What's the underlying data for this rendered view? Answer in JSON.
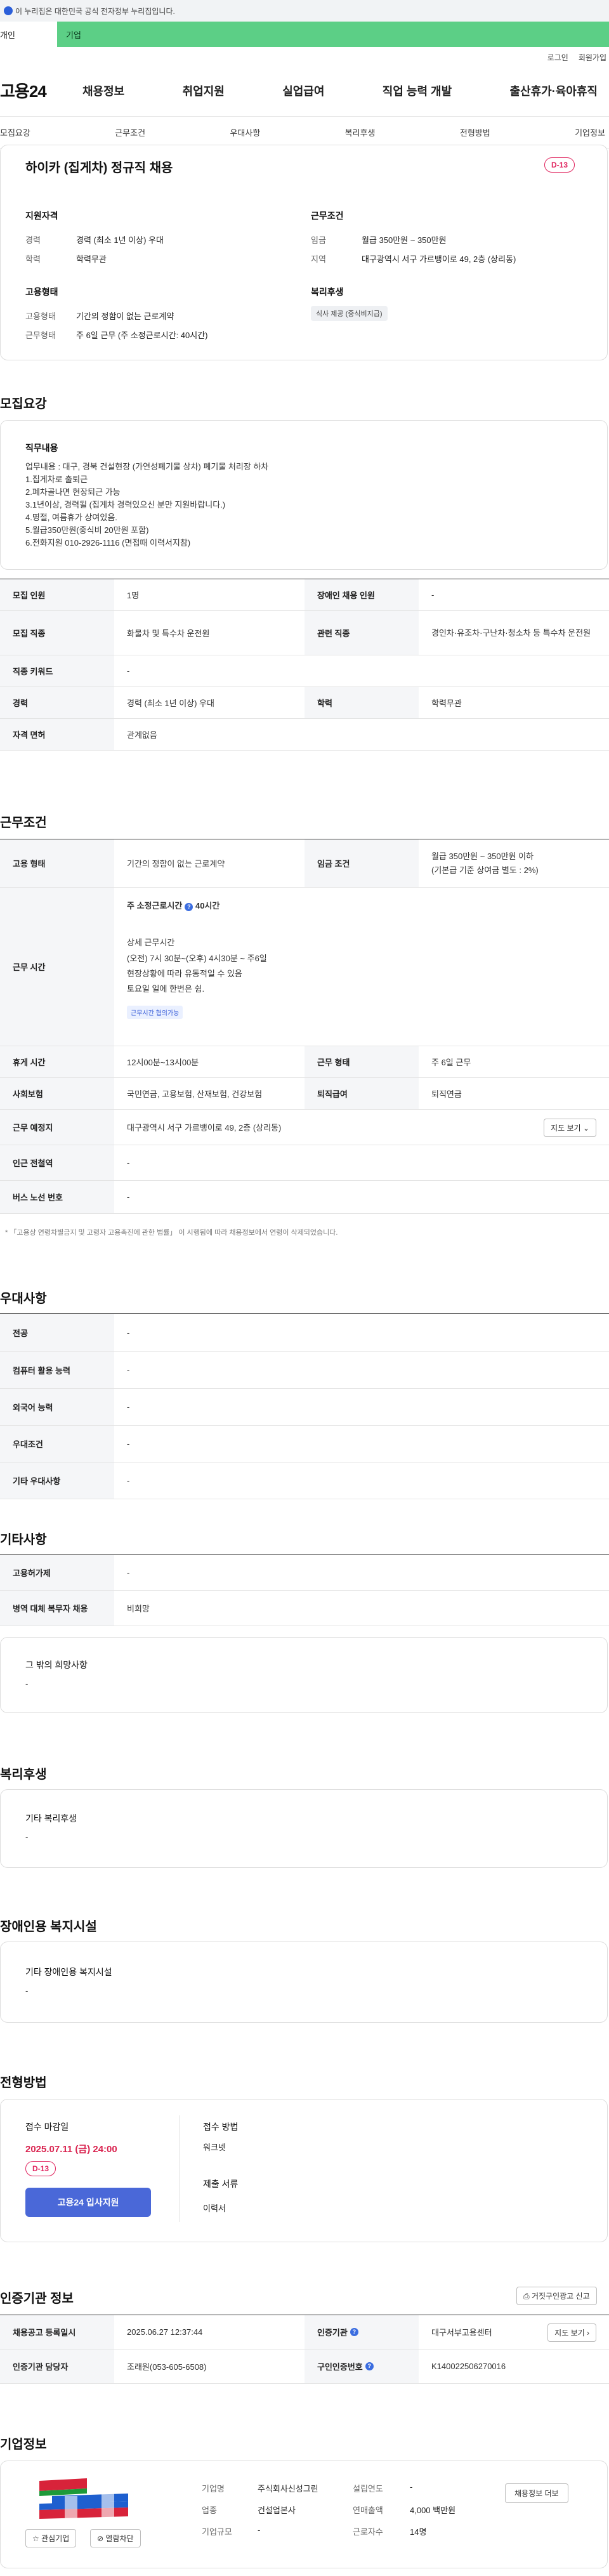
{
  "gov_banner": "이 누리집은 대한민국 공식 전자정부 누리집입니다.",
  "tabs": [
    "개인",
    "기업"
  ],
  "util": [
    "로그인",
    "회원가입"
  ],
  "logo": "고용24",
  "gnb": [
    "채용정보",
    "취업지원",
    "실업급여",
    "직업 능력 개발",
    "출산휴가·육아휴직"
  ],
  "anchors": [
    "모집요강",
    "근무조건",
    "우대사항",
    "복리후생",
    "전형방법",
    "기업정보"
  ],
  "summary": {
    "title": "하이카 (집게차) 정규직 채용",
    "dday": "D-13",
    "qual_title": "지원자격",
    "qual": [
      {
        "l": "경력",
        "v": "경력 (최소 1년 이상) 우대"
      },
      {
        "l": "학력",
        "v": "학력무관"
      }
    ],
    "cond_title": "근무조건",
    "cond": [
      {
        "l": "임금",
        "v": "월급 350만원 ~ 350만원"
      },
      {
        "l": "지역",
        "v": "대구광역시 서구 가르뱅이로 49, 2층 (상리동)"
      }
    ],
    "emp_title": "고용형태",
    "emp": [
      {
        "l": "고용형태",
        "v": "기간의 정함이 없는 근로계약"
      },
      {
        "l": "근무형태",
        "v": "주 6일 근무 (주 소정근로시간: 40시간)"
      }
    ],
    "welfare_title": "복리후생",
    "welfare_chip": "식사 제공 (중식비지급)"
  },
  "recruit": {
    "section": "모집요강",
    "job_title": "직무내용",
    "job_text": "업무내용 : 대구, 경북 건설현장 (가연성폐기물 상차) 폐기물 처리장 하차\n1.집게차로 출퇴근\n2.폐차골나면 현장퇴근 가능\n3.1년이상, 경력될 (집게차 경력있으신 분만 지원바랍니다.)\n4.명절, 여름휴가 상여있음.\n5.월급350만원(중식비 20만원 포함)\n6.전화지원 010-2926-1116 (면접때 이력서지참)",
    "rows": [
      {
        "h1": "모집 인원",
        "v1": "1명",
        "h2": "장애인 채용 인원",
        "v2": "-"
      },
      {
        "h1": "모집 직종",
        "v1": "화물차 및 특수차 운전원",
        "h2": "관련 직종",
        "v2": "경인차·유조차·구난차·청소차 등 특수차 운전원"
      },
      {
        "h1": "직종 키워드",
        "v1": "-"
      },
      {
        "h1": "경력",
        "v1": "경력 (최소 1년 이상) 우대",
        "h2": "학력",
        "v2": "학력무관"
      },
      {
        "h1": "자격 면허",
        "v1": "관계없음"
      }
    ]
  },
  "work": {
    "section": "근무조건",
    "emp_h": "고용 형태",
    "emp_v": "기간의 정함이 없는 근로계약",
    "wage_h": "임금 조건",
    "wage_v1": "월급 350만원 ~ 350만원 이하",
    "wage_v2": "(기본급 기준 상여금 별도 : 2%)",
    "time_h": "근무 시간",
    "time_label": "주 소정근로시간",
    "time_value": "40시간",
    "detail_title": "상세 근무시간",
    "detail_text": "(오전) 7시 30분~(오후) 4시30분 ~ 주6일\n현장상황에 따라 유동적일 수 있음\n토요일 일에 한번은 쉼.",
    "detail_tag": "근무시간 협의가능",
    "rows": [
      {
        "h1": "휴게 시간",
        "v1": "12시00분~13시00분",
        "h2": "근무 형태",
        "v2": "주 6일 근무"
      },
      {
        "h1": "사회보험",
        "v1": "국민연금, 고용보험, 산재보험, 건강보험",
        "h2": "퇴직급여",
        "v2": "퇴직연금"
      }
    ],
    "loc_h": "근무 예정지",
    "loc_v": "대구광역시 서구 가르뱅이로 49, 2층 (상리동)",
    "map_btn": "지도 보기",
    "station_h": "인근 전철역",
    "station_v": "-",
    "bus_h": "버스 노선 번호",
    "bus_v": "-",
    "notice": "* 「고용상 연령차별금지 및 고령자 고용촉진에 관한 법률」 이 시행됨에 따라 채용정보에서 연령이 삭제되었습니다."
  },
  "pref": {
    "section": "우대사항",
    "rows": [
      {
        "h": "전공",
        "v": "-"
      },
      {
        "h": "컴퓨터 활용 능력",
        "v": "-"
      },
      {
        "h": "외국어 능력",
        "v": "-"
      },
      {
        "h": "우대조건",
        "v": "-"
      },
      {
        "h": "기타 우대사항",
        "v": "-"
      }
    ]
  },
  "other": {
    "section": "기타사항",
    "rows": [
      {
        "h": "고용허가제",
        "v": "-"
      },
      {
        "h": "병역 대체 복무자 채용",
        "v": "비희망"
      }
    ],
    "box_title": "그 밖의 희망사항",
    "box_val": "-"
  },
  "benefit": {
    "section": "복리후생",
    "box_title": "기타 복리후생",
    "box_val": "-"
  },
  "disability": {
    "section": "장애인용 복지시설",
    "box_title": "기타 장애인용 복지시설",
    "box_val": "-"
  },
  "selection": {
    "section": "전형방법",
    "deadline_label": "접수 마감일",
    "deadline": "2025.07.11 (금) 24:00",
    "dday": "D-13",
    "apply_btn": "고용24 입사지원",
    "method_label": "접수 방법",
    "method": "워크넷",
    "docs_label": "제출 서류",
    "docs": "이력서"
  },
  "agency": {
    "section": "인증기관 정보",
    "report_btn": "거짓구인광고 신고",
    "rows": [
      {
        "h1": "채용공고 등록일시",
        "v1": "2025.06.27 12:37:44",
        "h2": "인증기관",
        "v2": "대구서부고용센터",
        "btn": "지도 보기"
      },
      {
        "h1": "인증기관 담당자",
        "v1": "조래원(053-605-6508)",
        "h2": "구인인증번호",
        "v2": "K140022506270016"
      }
    ]
  },
  "company": {
    "section": "기업정보",
    "fav_btn": "관심기업",
    "block_btn": "열람차단",
    "fields": [
      {
        "l": "기업명",
        "v": "주식회사신성그린"
      },
      {
        "l": "설립연도",
        "v": "-"
      },
      {
        "l": "업종",
        "v": "건설업본사"
      },
      {
        "l": "연매출액",
        "v": "4,000 백만원"
      },
      {
        "l": "기업규모",
        "v": "-"
      },
      {
        "l": "근로자수",
        "v": "14명"
      }
    ],
    "jobs_btn": "채용정보 더보"
  }
}
